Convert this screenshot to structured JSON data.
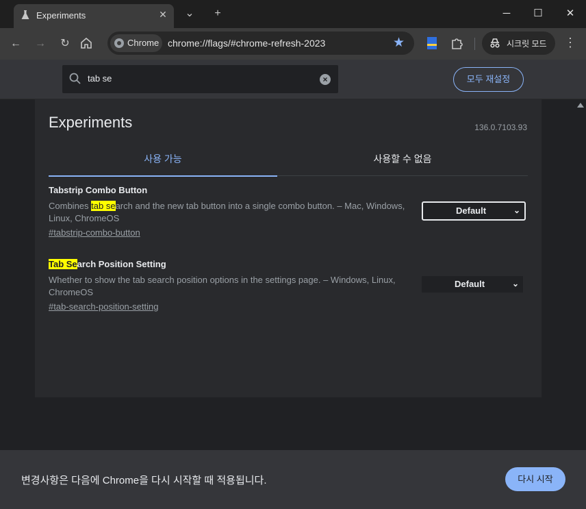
{
  "browser": {
    "tab_title": "Experiments",
    "url_chip": "Chrome",
    "url": "chrome://flags/#chrome-refresh-2023",
    "incognito_label": "시크릿 모드",
    "icons": [
      "flask-icon",
      "close-icon",
      "chevron-down-icon",
      "plus-icon",
      "minimize-icon",
      "maximize-icon",
      "window-close-icon",
      "back-icon",
      "forward-icon",
      "reload-icon",
      "home-icon",
      "star-icon",
      "puzzle-icon",
      "menu-icon"
    ]
  },
  "flags_header": {
    "search_value": "tab se",
    "reset_all_label": "모두 재설정"
  },
  "experiments": {
    "title": "Experiments",
    "version": "136.0.7103.93",
    "tabs": [
      "사용 가능",
      "사용할 수 없음"
    ],
    "flags": [
      {
        "name": "Tabstrip Combo Button",
        "desc_pre": "Combines ",
        "desc_hl": "tab se",
        "desc_post": "arch and the new tab button into a single combo button. – Mac, Windows, Linux, ChromeOS",
        "link": "#tabstrip-combo-button",
        "select_value": "Default"
      },
      {
        "name_hl": "Tab Se",
        "name_post": "arch Position Setting",
        "desc": "Whether to show the tab search position options in the settings page. – Windows, Linux, ChromeOS",
        "link": "#tab-search-position-setting",
        "select_value": "Default"
      }
    ]
  },
  "footer": {
    "message": "변경사항은 다음에 Chrome을 다시 시작할 때 적용됩니다.",
    "relaunch_label": "다시 시작"
  },
  "colors": {
    "accent": "#8ab4f8",
    "highlight": "#ffff00",
    "background": "#202124"
  }
}
